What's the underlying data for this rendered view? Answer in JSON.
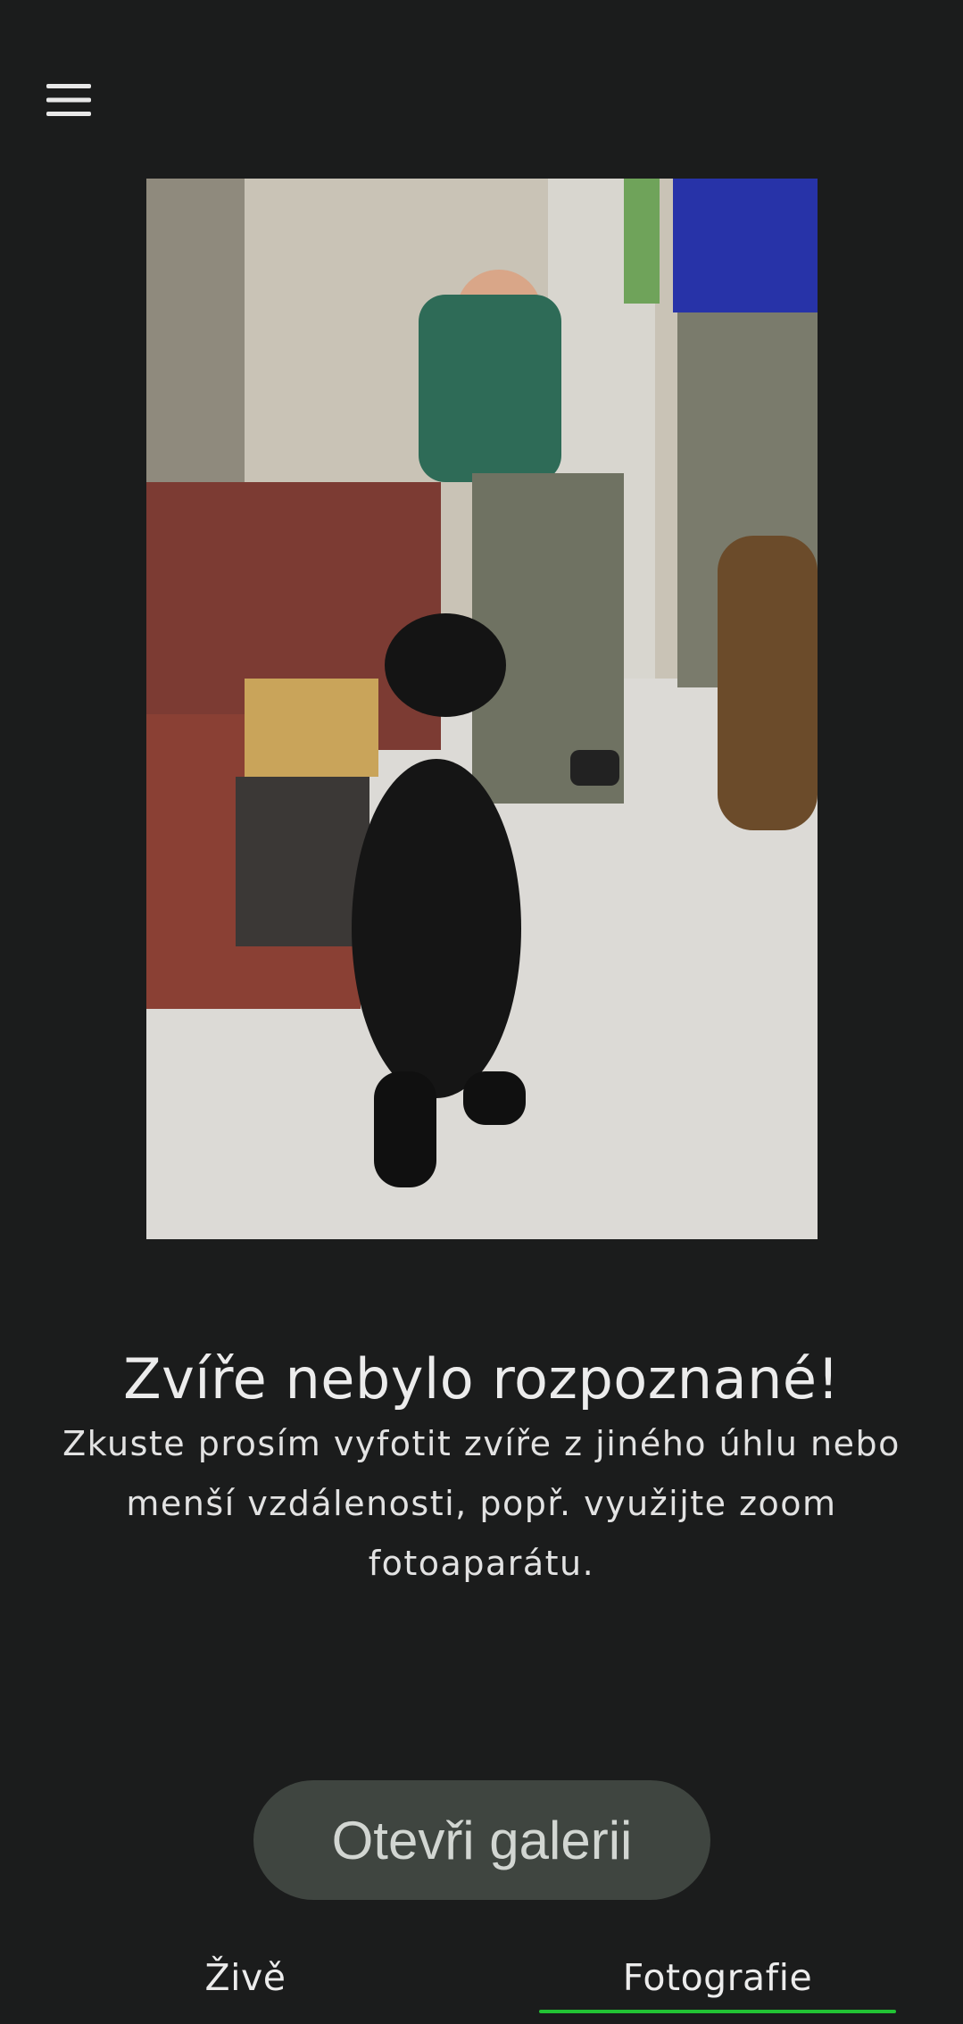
{
  "header": {
    "menu_icon": "hamburger-menu-icon"
  },
  "photo": {
    "subject": "photo-placeholder"
  },
  "result": {
    "title": "Zvíře nebylo rozpoznané!",
    "message": "Zkuste prosím vyfotit zvíře z jiného úhlu nebo menší vzdálenosti, popř. využijte zoom fotoaparátu."
  },
  "actions": {
    "open_gallery_label": "Otevři galerii"
  },
  "tabs": [
    {
      "label": "Živě",
      "active": false
    },
    {
      "label": "Fotografie",
      "active": true
    }
  ],
  "colors": {
    "background": "#1b1c1c",
    "accent": "#22c234",
    "button_bg": "#3f4540"
  }
}
